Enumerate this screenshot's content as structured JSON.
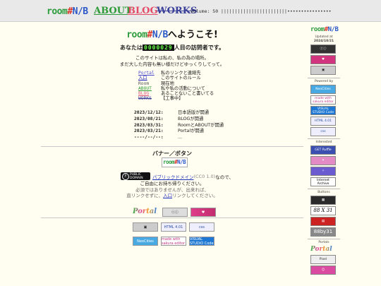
{
  "header": {
    "logo": {
      "room": "room",
      "hash": "#",
      "nb": "N/B"
    },
    "nav": {
      "about": "ABOUT",
      "blog": "BLOG",
      "works": "WORKS"
    },
    "volume": "Volume: 50 ||||||||||||||||||||||||••••••••••••••••"
  },
  "main": {
    "welcome_suffix": "へようこそ!",
    "counter_prefix": "あなたは",
    "counter_value": "0000029",
    "counter_suffix": "人目の訪問者です。",
    "intro_line1": "このサイトは私の、私の為の場所。",
    "intro_line2": "まだ大した内容も無い様だけどゆっくりしてって。",
    "menu": [
      {
        "key": "Portal",
        "desc": "私のリンクと連絡先"
      },
      {
        "key": "入口",
        "desc": "このサイトのルール"
      },
      {
        "key": "Room",
        "desc": "現在地"
      },
      {
        "key": "ABOUT",
        "desc": "私や私の活動について"
      },
      {
        "key": "BLOG",
        "desc": "あることないこと書いてる"
      },
      {
        "key": "WORKS",
        "desc": "【工事中】"
      }
    ],
    "updates": [
      {
        "date": "2023/12/12:",
        "text": "日本語版が開通"
      },
      {
        "date": "2023/08/21:",
        "text": "BLOGが開通"
      },
      {
        "date": "2023/03/31:",
        "text": "RoomとABOUTが開通"
      },
      {
        "date": "2023/03/21:",
        "text": "Portalが開通"
      },
      {
        "date": "----/--/--:",
        "text": "..."
      }
    ],
    "banner_title": "バナー／ボタン",
    "license": {
      "badge_top": "PUBLIC",
      "badge_bottom": "DOMAIN",
      "link": "パブリックドメイン",
      "note": "(CC0 1.0)",
      "after": "なので、",
      "line2": "ご自由にお持ち帰りください。",
      "line3": "必須ではありませんが、出来れば、",
      "line4_pre": "直リンクせずに、",
      "line4_link": "入口",
      "line4_post": "リンクしてください。"
    },
    "buttons": {
      "portal": "Portal",
      "html": "HTML 4.01",
      "css": "css",
      "neocities": "NeoCities",
      "sakura": "made with sakura editor",
      "vscode": "VISUAL STUDIO Code"
    }
  },
  "sidebar": {
    "updated_label": "Updated at",
    "updated_date": "2024/10/21",
    "powered_by": "Powered by",
    "interested": "Interested",
    "buttons_label": "Buttons",
    "portals_label": "Portals",
    "neocities": "NeoCities",
    "sakura": "made with sakura editor",
    "vscode": "VISUAL STUDIO Code",
    "html": "HTML 4.01",
    "css": "css",
    "ruffle": "GET Ruffle",
    "archive": "Internet Archive",
    "b88x31": "88 X 31",
    "b88by31": "88by31",
    "portal": "Portal",
    "pixel": "Pixel"
  }
}
